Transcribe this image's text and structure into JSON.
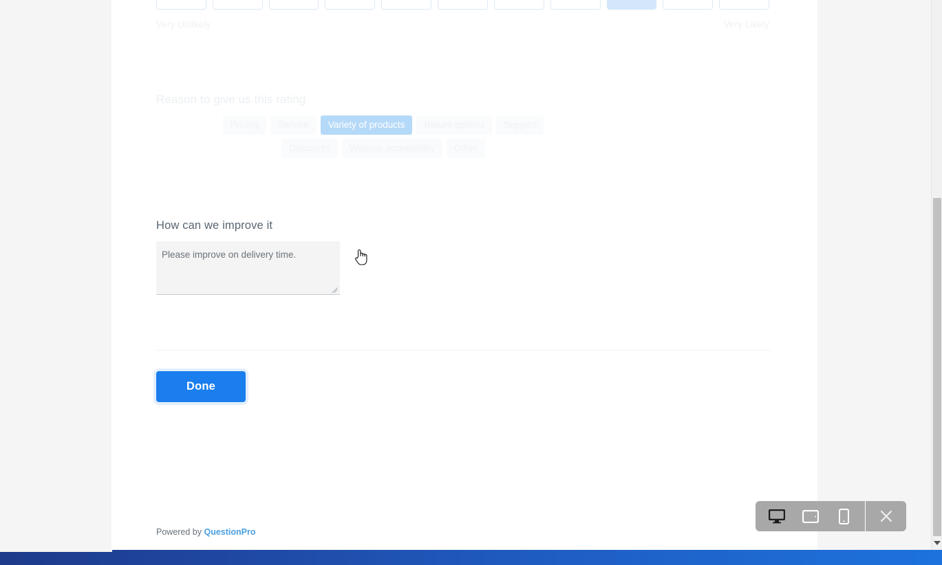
{
  "survey": {
    "nps": {
      "box_count": 11,
      "selected_index": 8,
      "left_label": "Very Unlikely",
      "right_label": "Very Likely"
    },
    "reason": {
      "heading": "Reason to give us this rating",
      "selected_tag": "Variety of products",
      "row1": [
        "Pricing",
        "Service",
        "Variety of products",
        "Return options",
        "Support"
      ],
      "row2": [
        "Discounts",
        "Website accessibility",
        "Other"
      ]
    },
    "improve": {
      "heading": "How can we improve it",
      "value": "Please improve on delivery time.",
      "placeholder": ""
    },
    "submit": {
      "label": "Done"
    },
    "footer": {
      "prefix": "Powered by ",
      "brand": "QuestionPro"
    }
  },
  "device_toolbar": {
    "buttons": [
      {
        "name": "desktop-view",
        "active": true
      },
      {
        "name": "tablet-view",
        "active": false
      },
      {
        "name": "mobile-view",
        "active": false
      }
    ],
    "close_label": "×"
  },
  "colors": {
    "accent_blue": "#1a7eee",
    "selected_tag_bg": "#b5d9f8",
    "selected_nps_bg": "#d3e6fb",
    "brand_link": "#4a9fe0",
    "toolbar_gray": "#a8a8a8",
    "scrollbar_thumb": "#c1c1c1"
  }
}
